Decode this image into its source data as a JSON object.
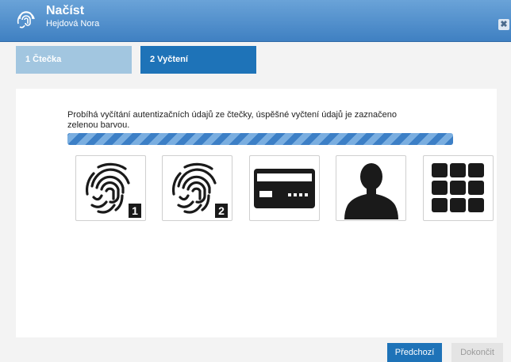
{
  "window": {
    "title": "Načíst",
    "subtitle": "Hejdová Nora",
    "close_glyph": "✖"
  },
  "steps": [
    {
      "label": "1 Čtečka",
      "active": false
    },
    {
      "label": "2 Vyčtení",
      "active": true
    }
  ],
  "panel": {
    "message": "Probíhá vyčítání autentizačních údajů ze čtečky, úspěšné vyčtení údajů je zaznačeno zelenou barvou.",
    "progress_animated": true
  },
  "tiles": [
    {
      "icon": "fingerprint-1-icon",
      "badge": "1"
    },
    {
      "icon": "fingerprint-2-icon",
      "badge": "2"
    },
    {
      "icon": "card-icon"
    },
    {
      "icon": "person-icon"
    },
    {
      "icon": "keypad-icon"
    }
  ],
  "buttons": {
    "previous": "Předchozí",
    "finish": "Dokončit"
  },
  "colors": {
    "accent": "#1e73b8",
    "inactive_step": "#a2c6e0",
    "titlebar": "#4a8ccb"
  }
}
